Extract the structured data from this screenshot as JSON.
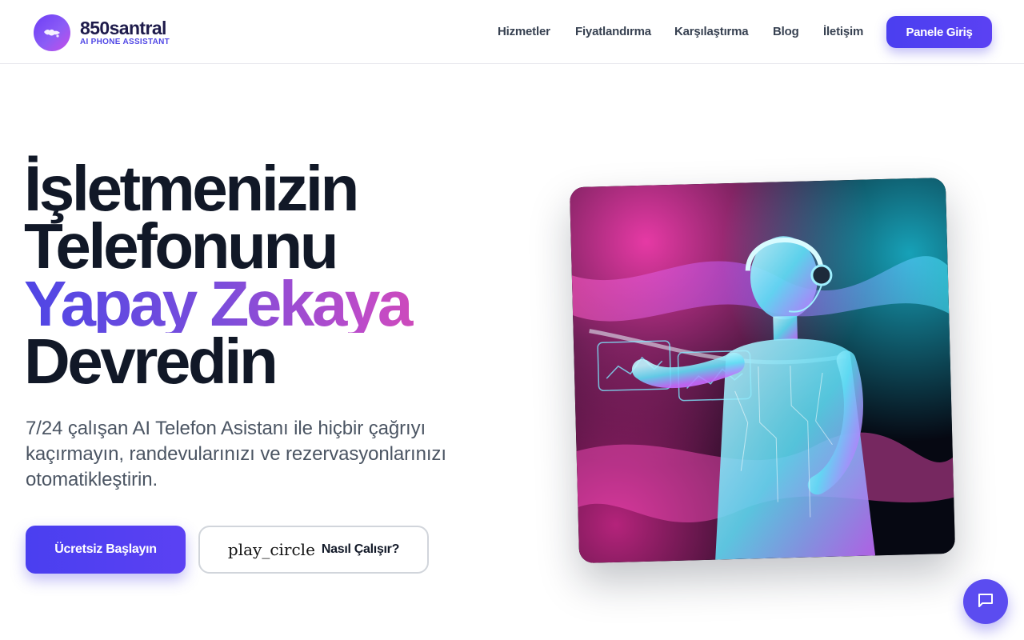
{
  "brand": {
    "name": "850santral",
    "tagline": "AI PHONE ASSISTANT"
  },
  "nav": {
    "items": [
      {
        "label": "Hizmetler"
      },
      {
        "label": "Fiyatlandırma"
      },
      {
        "label": "Karşılaştırma"
      },
      {
        "label": "Blog"
      },
      {
        "label": "İletişim"
      }
    ],
    "cta_label": "Panele Giriş"
  },
  "hero": {
    "title_line1": "İşletmenizin",
    "title_line2": "Telefonunu",
    "title_line3": "Yapay Zekaya",
    "title_line4": "Devredin",
    "subtitle": "7/24 çalışan AI Telefon Asistanı ile hiçbir çağrıyı kaçırmayın, randevularınızı ve rezervasyonlarınızı otomatikleştirin.",
    "primary_button": "Ücretsiz Başlayın",
    "secondary_button_icon": "play_circle",
    "secondary_button": "Nasıl Çalışır?"
  },
  "colors": {
    "primary": "#4f46e5",
    "gradient_start": "#4f46e5",
    "gradient_end": "#ec4899",
    "heading": "#111827",
    "body_text": "#4b5563"
  },
  "icons": {
    "logo": "globe-icon",
    "chat": "chat-bubble-icon",
    "hero_image": "ai-robot-assistant-image"
  }
}
